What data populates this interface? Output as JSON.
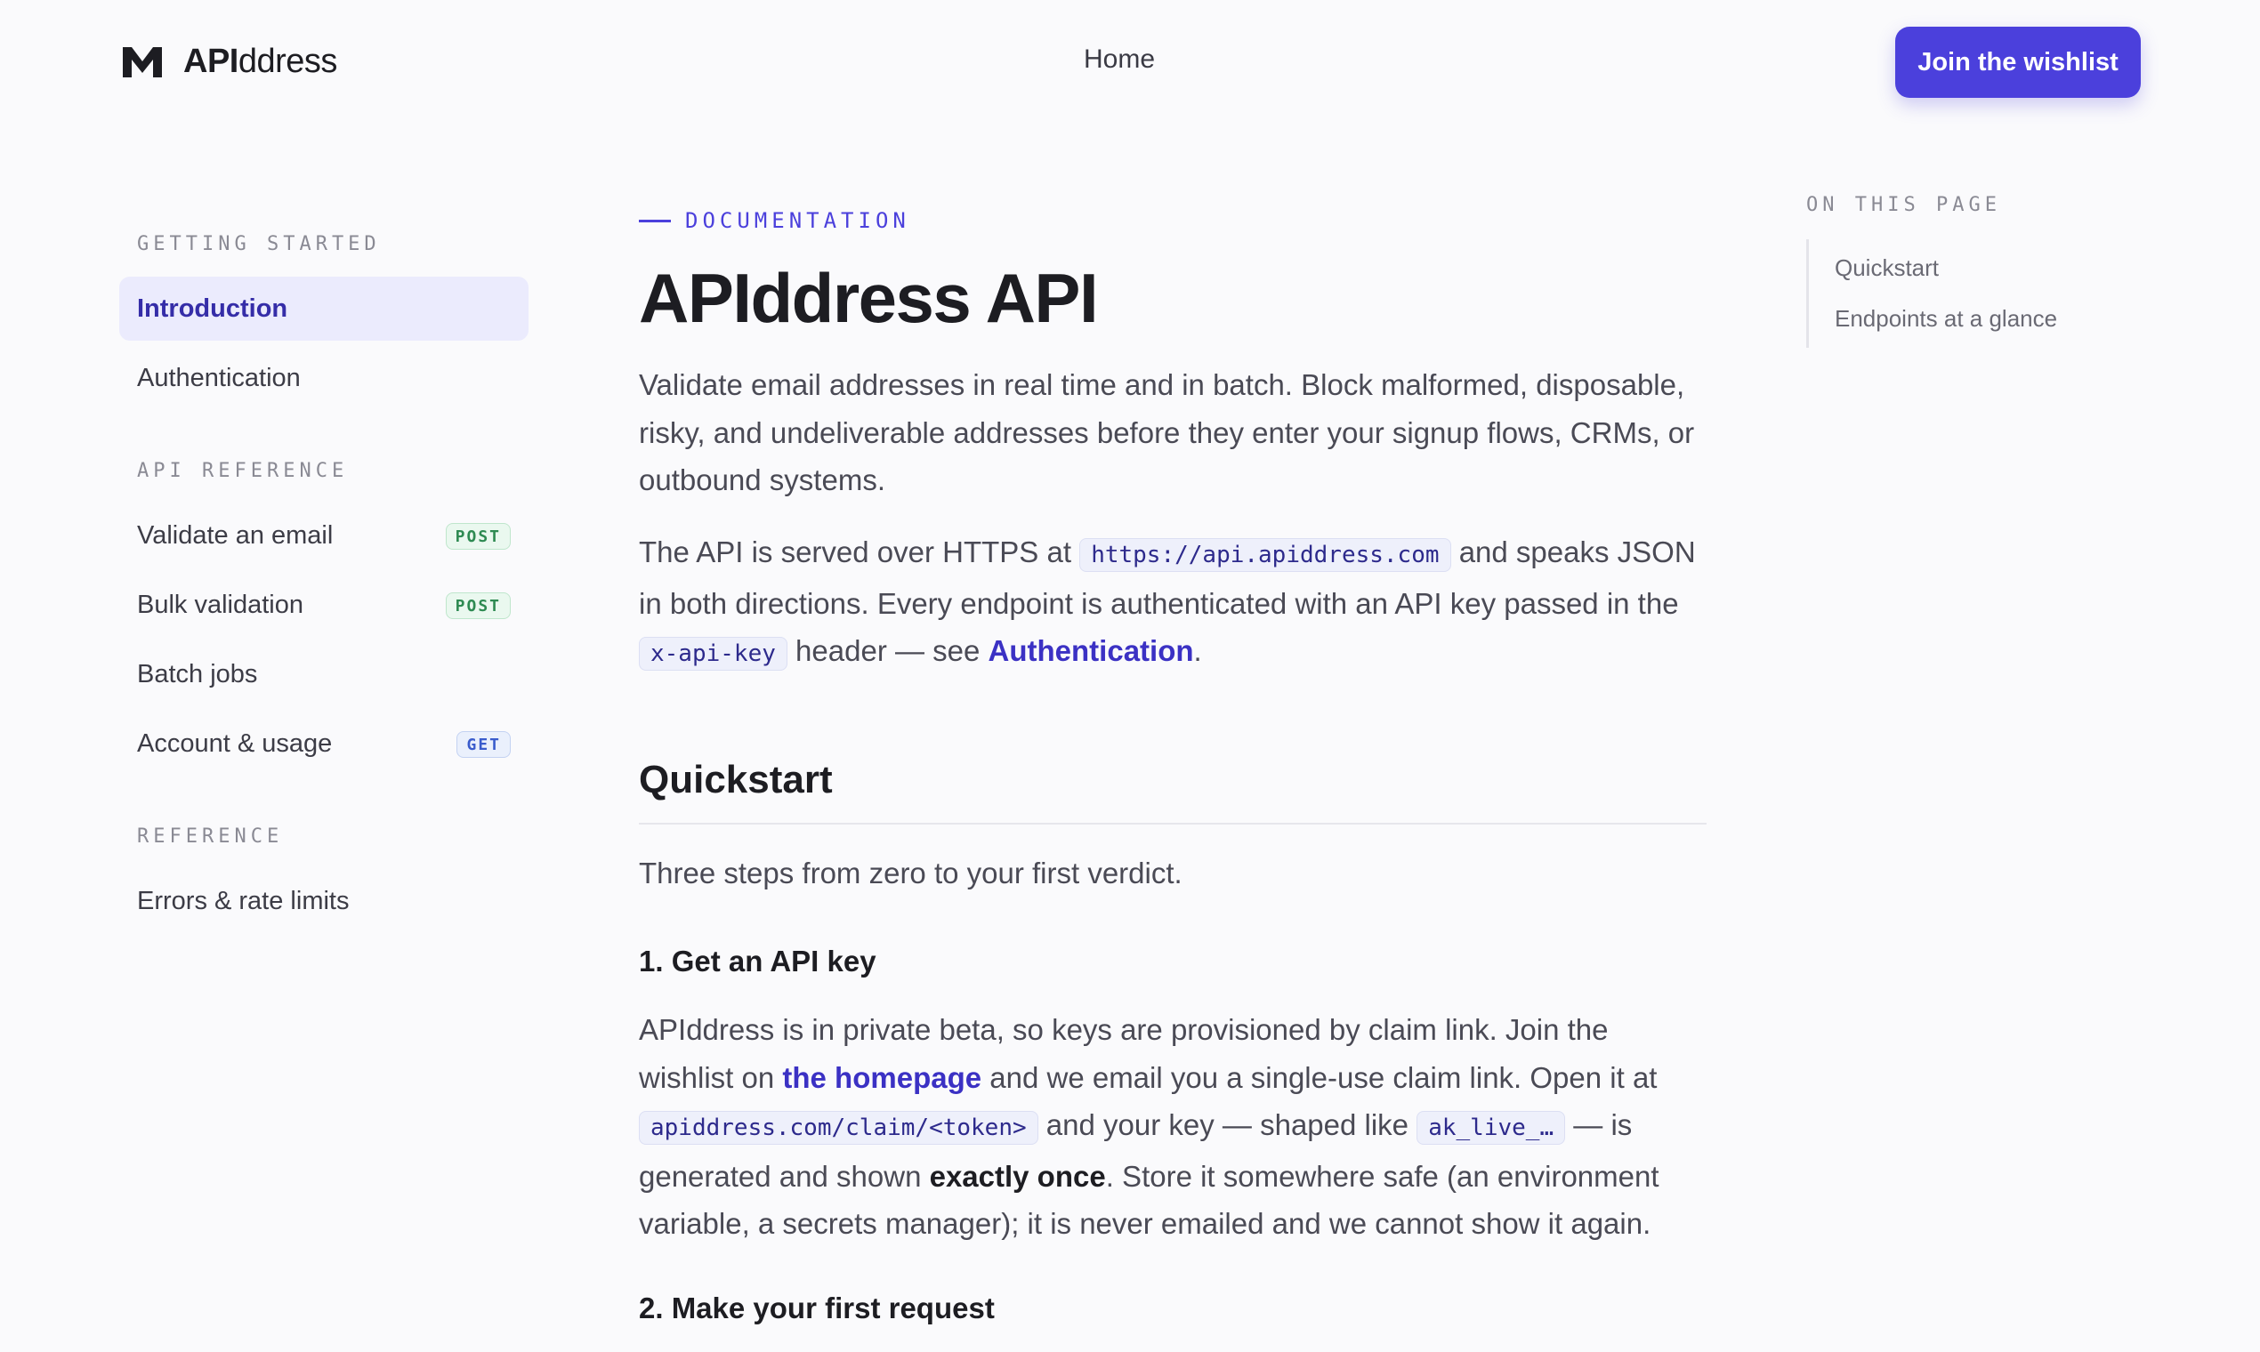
{
  "header": {
    "brand_bold": "API",
    "brand_rest": "ddress",
    "nav_home": "Home",
    "cta_label": "Join the wishlist"
  },
  "sidebar": {
    "sections": [
      {
        "title": "GETTING STARTED",
        "items": [
          {
            "label": "Introduction",
            "active": true
          },
          {
            "label": "Authentication"
          }
        ]
      },
      {
        "title": "API REFERENCE",
        "items": [
          {
            "label": "Validate an email",
            "badge": "POST"
          },
          {
            "label": "Bulk validation",
            "badge": "POST"
          },
          {
            "label": "Batch jobs"
          },
          {
            "label": "Account & usage",
            "badge": "GET"
          }
        ]
      },
      {
        "title": "REFERENCE",
        "items": [
          {
            "label": "Errors & rate limits"
          }
        ]
      }
    ]
  },
  "main": {
    "eyebrow": "DOCUMENTATION",
    "title": "APIddress API",
    "lead": "Validate email addresses in real time and in batch. Block malformed, disposable, risky, and undeliverable addresses before they enter your signup flows, CRMs, or outbound systems.",
    "intro": {
      "t1": "The API is served over HTTPS at ",
      "code1": "https://api.apiddress.com",
      "t2": " and speaks JSON in both directions. Every endpoint is authenticated with an API key passed in the ",
      "code2": "x-api-key",
      "t3": " header — see ",
      "link": "Authentication",
      "t4": "."
    },
    "quickstart_title": "Quickstart",
    "quickstart_lead": "Three steps from zero to your first verdict.",
    "step1": {
      "title": "1. Get an API key",
      "t1": "APIddress is in private beta, so keys are provisioned by claim link. Join the wishlist on ",
      "link": "the homepage",
      "t2": " and we email you a single-use claim link. Open it at ",
      "code1": "apiddress.com/claim/<token>",
      "t3": " and your key — shaped like ",
      "code2": "ak_live_…",
      "t4": " — is generated and shown ",
      "bold": "exactly once",
      "t5": ". Store it somewhere safe (an environment variable, a secrets manager); it is never emailed and we cannot show it again."
    },
    "step2_title": "2. Make your first request"
  },
  "toc": {
    "title": "ON THIS PAGE",
    "items": [
      "Quickstart",
      "Endpoints at a glance"
    ]
  },
  "colors": {
    "accent": "#4b40dc",
    "link": "#3b31c4",
    "active_bg": "#ebebfd",
    "post_badge": "#2e8a52",
    "get_badge": "#3a5ccc"
  }
}
